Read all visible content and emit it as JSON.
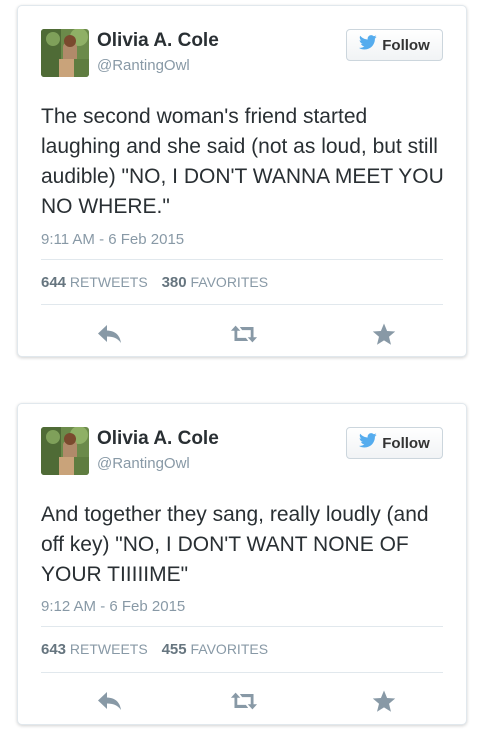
{
  "tweets": [
    {
      "author_name": "Olivia A. Cole",
      "author_handle": "@RantingOwl",
      "follow_label": "Follow",
      "text": "The second woman's friend started laughing and she said (not as loud, but still audible) \"NO, I DON'T WANNA MEET YOU NO WHERE.\"",
      "timestamp": "9:11 AM - 6 Feb 2015",
      "retweets": "644",
      "retweets_label": "RETWEETS",
      "favorites": "380",
      "favorites_label": "FAVORITES"
    },
    {
      "author_name": "Olivia A. Cole",
      "author_handle": "@RantingOwl",
      "follow_label": "Follow",
      "text": "And together they sang, really loudly (and off key) \"NO, I DON'T WANT NONE OF YOUR TIIIIIME\"",
      "timestamp": "9:12 AM - 6 Feb 2015",
      "retweets": "643",
      "retweets_label": "RETWEETS",
      "favorites": "455",
      "favorites_label": "FAVORITES"
    }
  ],
  "icons": {
    "follow": "twitter-bird-icon",
    "reply": "reply-icon",
    "retweet": "retweet-icon",
    "favorite": "star-icon"
  },
  "colors": {
    "twitter_blue": "#55acee",
    "action_gray": "#8899a6",
    "text": "#292f33",
    "muted": "#8899a6"
  }
}
